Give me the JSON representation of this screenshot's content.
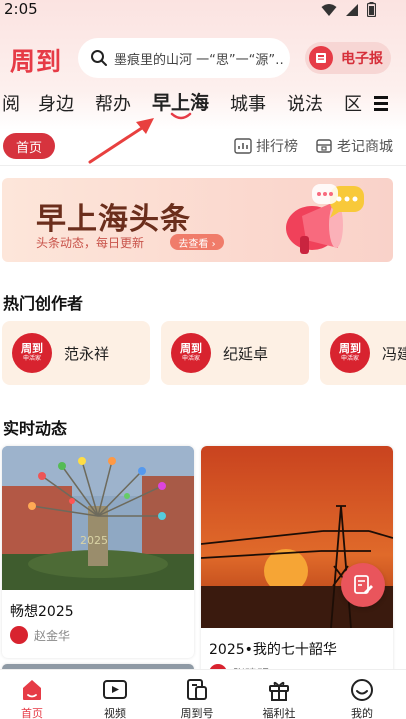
{
  "status": {
    "time": "2:05"
  },
  "header": {
    "logo": "周到",
    "search_placeholder": "墨痕里的山河 一“思”一“源”…",
    "epaper_label": "电子报"
  },
  "tabs": [
    {
      "label": "阅"
    },
    {
      "label": "身边"
    },
    {
      "label": "帮办"
    },
    {
      "label": "早上海"
    },
    {
      "label": "城事"
    },
    {
      "label": "说法"
    },
    {
      "label": "区"
    }
  ],
  "subbar": {
    "home_label": "首页",
    "rank_label": "排行榜",
    "mall_label": "老记商城"
  },
  "banner": {
    "title": "早上海头条",
    "subtitle": "头条动态，每日更新",
    "button": "去查看 ›"
  },
  "creators_section": {
    "title": "热门创作者",
    "avatar_line1": "周到",
    "avatar_line2": "申活家",
    "items": [
      {
        "name": "范永祥"
      },
      {
        "name": "纪延卓"
      },
      {
        "name": "冯建"
      }
    ]
  },
  "feed_section": {
    "title": "实时动态",
    "cards": [
      {
        "title": "畅想2025",
        "author": "赵金华",
        "image_caption": "2025"
      },
      {
        "title": "2025•我的七十韶华",
        "author": "张建明"
      }
    ]
  },
  "bottom_nav": [
    {
      "label": "首页",
      "icon": "home-icon"
    },
    {
      "label": "视频",
      "icon": "video-icon"
    },
    {
      "label": "周到号",
      "icon": "account-icon"
    },
    {
      "label": "福利社",
      "icon": "gift-icon"
    },
    {
      "label": "我的",
      "icon": "profile-icon"
    }
  ],
  "colors": {
    "brand_red": "#e63b46",
    "home_pill": "#d6333e"
  }
}
